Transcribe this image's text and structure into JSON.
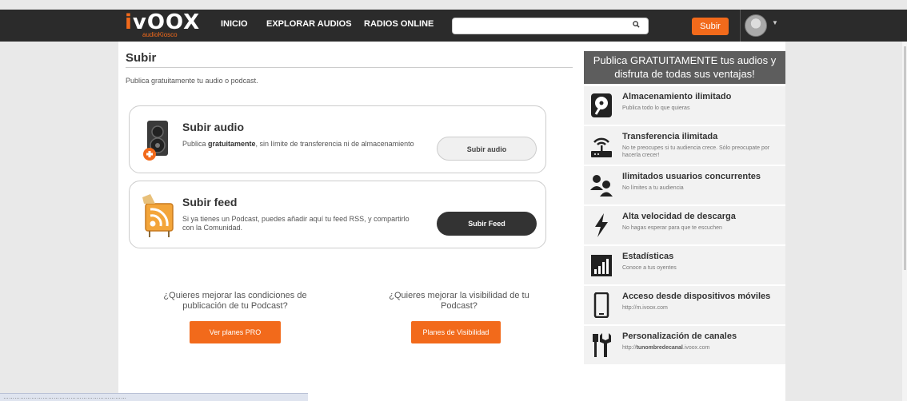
{
  "header": {
    "logo_main": "vOOX",
    "logo_i": "i",
    "logo_sub": "audioKiosco",
    "nav": [
      "INICIO",
      "EXPLORAR AUDIOS",
      "RADIOS ONLINE"
    ],
    "search_placeholder": "",
    "search_icon": "search-icon",
    "upload_label": "Subir",
    "accent": "#f26a1b"
  },
  "main": {
    "title": "Subir",
    "intro": "Publica gratuitamente tu audio o podcast.",
    "cards": [
      {
        "title": "Subir audio",
        "desc_pre": "Publica ",
        "desc_bold": "gratuitamente",
        "desc_post": ", sin límite de transferencia ni de almacenamiento",
        "button": "Subir audio"
      },
      {
        "title": "Subir feed",
        "desc": "Si ya tienes un Podcast, puedes añadir aquí tu feed RSS, y compartirlo con la Comunidad.",
        "button": "Subir Feed"
      }
    ],
    "promos": [
      {
        "text": "¿Quieres mejorar las condiciones de publicación de tu Podcast?",
        "button": "Ver planes PRO"
      },
      {
        "text": "¿Quieres mejorar la visibilidad de tu Podcast?",
        "button": "Planes de Visibilidad"
      }
    ]
  },
  "sidebar": {
    "banner": "Publica GRATUITAMENTE tus audios y disfruta de todas sus ventajas!",
    "features": [
      {
        "title": "Almacenamiento ilimitado",
        "desc": "Publica todo lo que quieras",
        "icon": "hard-drive-icon"
      },
      {
        "title": "Transferencia ilimitada",
        "desc": "No te preocupes si tu audiencia crece. Sólo preocupate por hacerla crecer!",
        "icon": "router-icon"
      },
      {
        "title": "Ilimitados usuarios concurrentes",
        "desc": "No límites a tu audiencia",
        "icon": "users-icon"
      },
      {
        "title": "Alta velocidad de descarga",
        "desc": "No hagas esperar para que te escuchen",
        "icon": "lightning-icon"
      },
      {
        "title": "Estadísticas",
        "desc": "Conoce a tus oyentes",
        "icon": "bar-chart-icon"
      },
      {
        "title": "Acceso desde dispositivos móviles",
        "desc": "http://m.ivoox.com",
        "icon": "mobile-icon"
      },
      {
        "title": "Personalización de canales",
        "desc_pre": "http://",
        "desc_bold": "tunombredecanal",
        "desc_post": ".ivoox.com",
        "icon": "tools-icon"
      }
    ]
  },
  "statusbar": {
    "text": "…………………………………………………………"
  }
}
